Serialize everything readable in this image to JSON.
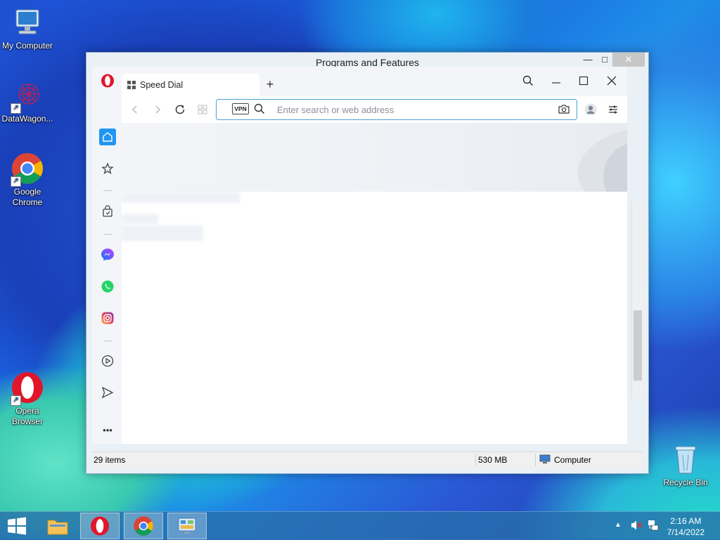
{
  "desktop": {
    "icons": [
      {
        "label": "My Computer"
      },
      {
        "label": "DataWagon..."
      },
      {
        "label": "Google Chrome"
      },
      {
        "label": "Opera Browser"
      },
      {
        "label": "Recycle Bin"
      }
    ]
  },
  "programs_window": {
    "title": "Programs and Features",
    "status": {
      "items": "29 items",
      "size": "530 MB",
      "location": "Computer"
    }
  },
  "opera": {
    "tab": {
      "label": "Speed Dial"
    },
    "new_tab_label": "+",
    "address": {
      "placeholder": "Enter search or web address",
      "value": "",
      "vpn_label": "VPN"
    },
    "sidebar": [
      "home-icon",
      "star-icon",
      "bag-icon",
      "messenger-icon",
      "whatsapp-icon",
      "instagram-icon",
      "player-icon",
      "send-icon",
      "more-icon"
    ],
    "more_label": "•••",
    "colors": {
      "accent": "#2196f3",
      "opera_red": "#e0162b"
    }
  },
  "taskbar": {
    "clock": {
      "time": "2:16 AM",
      "date": "7/14/2022"
    }
  }
}
